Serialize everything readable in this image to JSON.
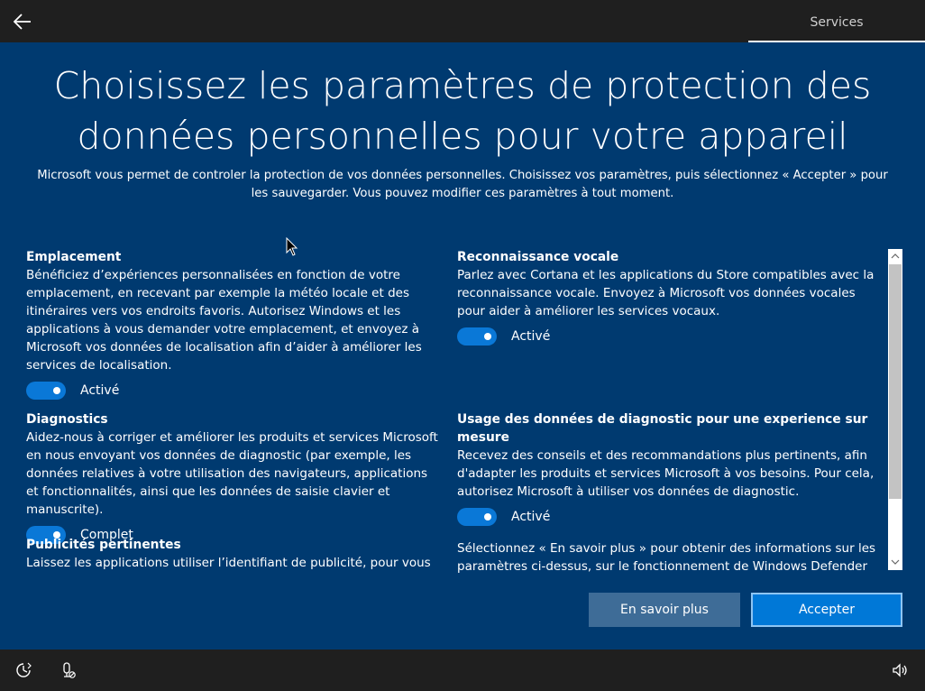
{
  "header": {
    "services_tab": "Services"
  },
  "main": {
    "title": "Choisissez les paramètres de protection des données personnelles pour votre appareil",
    "subtitle": "Microsoft vous permet de controler la protection de vos données personnelles. Choisissez vos paramètres, puis sélectionnez « Accepter » pour les sauvegarder. Vous pouvez modifier ces paramètres à tout moment."
  },
  "settings": {
    "location": {
      "title": "Emplacement",
      "description": "Bénéficiez d’expériences personnalisées en fonction de votre emplacement, en recevant par exemple la météo locale et des itinéraires vers vos endroits favoris. Autorisez Windows et les applications à vous demander votre emplacement, et envoyez à Microsoft vos données de localisation afin d’aider à améliorer les services de localisation.",
      "state": "Activé"
    },
    "speech": {
      "title": "Reconnaissance vocale",
      "description": "Parlez avec Cortana et les applications du Store compatibles avec la reconnaissance vocale. Envoyez à Microsoft vos données vocales pour aider à améliorer les services vocaux.",
      "state": "Activé"
    },
    "diagnostics": {
      "title": "Diagnostics",
      "description": "Aidez-nous à corriger et améliorer les produits et services Microsoft en nous envoyant vos données de diagnostic (par exemple, les données relatives à votre utilisation des navigateurs, applications et fonctionnalités, ainsi que les données de saisie clavier et manuscrite).",
      "state": "Complet"
    },
    "tailored": {
      "title": "Usage des données de diagnostic pour une experience sur mesure",
      "description": "Recevez des conseils et des recommandations plus pertinents, afin d'adapter les produits et services Microsoft à vos besoins. Pour cela, autorisez Microsoft à utiliser vos données de diagnostic.",
      "state": "Activé"
    },
    "ads": {
      "title": "Publicités pertinentes",
      "description": "Laissez les applications utiliser l’identifiant de publicité, pour vous"
    },
    "learn_more_text": "Sélectionnez « En savoir plus » pour obtenir des informations sur les paramètres ci-dessus, sur le fonctionnement de Windows Defender"
  },
  "buttons": {
    "learn_more": "En savoir plus",
    "accept": "Accepter"
  },
  "colors": {
    "background": "#003a70",
    "toggle_on": "#0a78d7",
    "accent": "#0078d7",
    "bar": "#1f1f1f"
  },
  "icons": {
    "back": "back-arrow-icon",
    "ease_of_access": "ease-of-access-icon",
    "microphone": "microphone-off-icon",
    "volume": "volume-icon"
  }
}
